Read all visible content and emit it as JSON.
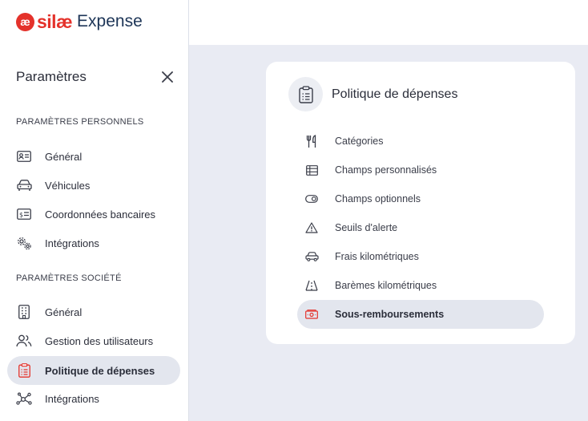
{
  "logo": {
    "brand": "silæ",
    "product": "Expense",
    "mark": "æ"
  },
  "sidebar": {
    "title": "Paramètres",
    "personal_label": "PARAMÈTRES PERSONNELS",
    "personal_items": [
      {
        "label": "Général",
        "icon": "id-card-icon"
      },
      {
        "label": "Véhicules",
        "icon": "car-icon"
      },
      {
        "label": "Coordonnées bancaires",
        "icon": "bank-card-icon"
      },
      {
        "label": "Intégrations",
        "icon": "gears-icon"
      }
    ],
    "company_label": "PARAMÈTRES SOCIÉTÉ",
    "company_items": [
      {
        "label": "Général",
        "icon": "building-icon"
      },
      {
        "label": "Gestion des utilisateurs",
        "icon": "users-icon"
      },
      {
        "label": "Politique de dépenses",
        "icon": "clipboard-icon",
        "active": true
      },
      {
        "label": "Intégrations",
        "icon": "network-icon"
      }
    ]
  },
  "card": {
    "title": "Politique de dépenses",
    "items": [
      {
        "label": "Catégories",
        "icon": "fork-knife-icon"
      },
      {
        "label": "Champs personnalisés",
        "icon": "table-icon"
      },
      {
        "label": "Champs optionnels",
        "icon": "toggle-icon"
      },
      {
        "label": "Seuils d'alerte",
        "icon": "warning-icon"
      },
      {
        "label": "Frais kilométriques",
        "icon": "car-icon"
      },
      {
        "label": "Barèmes kilométriques",
        "icon": "road-icon"
      },
      {
        "label": "Sous-remboursements",
        "icon": "money-icon",
        "active": true
      }
    ]
  },
  "colors": {
    "accent": "#e4322b",
    "active_bg": "#e3e6ee",
    "page_bg": "#e9ebf3"
  }
}
